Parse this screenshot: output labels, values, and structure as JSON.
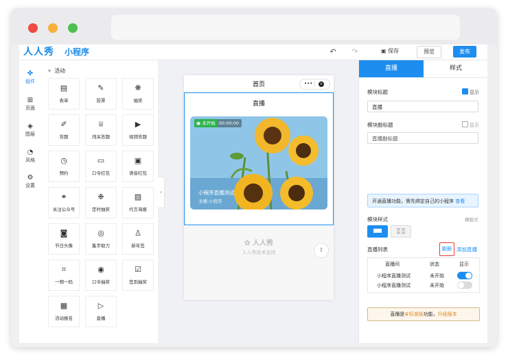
{
  "header": {
    "logo": "人人秀",
    "logo_sub": "小程序",
    "save_label": "保存",
    "preview_label": "预览",
    "publish_label": "发布",
    "colors": {
      "accent": "#1d8ef0",
      "brand": "#1a8ce8"
    }
  },
  "rail": [
    {
      "label": "组件",
      "icon": "puzzle-icon"
    },
    {
      "label": "页面",
      "icon": "plus-square-icon"
    },
    {
      "label": "图层",
      "icon": "layers-icon"
    },
    {
      "label": "风格",
      "icon": "palette-icon"
    },
    {
      "label": "设置",
      "icon": "settings-icon"
    }
  ],
  "components": {
    "section_title": "活动",
    "items": [
      {
        "label": "表单",
        "icon": "form-icon"
      },
      {
        "label": "投票",
        "icon": "vote-icon"
      },
      {
        "label": "抽奖",
        "icon": "lottery-icon"
      },
      {
        "label": "答题",
        "icon": "pen-icon"
      },
      {
        "label": "闯关答题",
        "icon": "trophy-icon"
      },
      {
        "label": "视频答题",
        "icon": "video-icon"
      },
      {
        "label": "预约",
        "icon": "clock-icon"
      },
      {
        "label": "口令红包",
        "icon": "envelope-icon"
      },
      {
        "label": "语音红包",
        "icon": "voice-envelope-icon"
      },
      {
        "label": "关注公众号",
        "icon": "follow-icon"
      },
      {
        "label": "定时抽奖",
        "icon": "timer-lottery-icon"
      },
      {
        "label": "代言海报",
        "icon": "poster-icon"
      },
      {
        "label": "节日头像",
        "icon": "avatar-frame-icon"
      },
      {
        "label": "集字助力",
        "icon": "char-collect-icon"
      },
      {
        "label": "新年签",
        "icon": "lot-icon"
      },
      {
        "label": "一物一码",
        "icon": "scan-code-icon"
      },
      {
        "label": "口令抽奖",
        "icon": "compass-icon"
      },
      {
        "label": "签到抽奖",
        "icon": "checkin-icon"
      },
      {
        "label": "活动报名",
        "icon": "signup-icon"
      },
      {
        "label": "直播",
        "icon": "live-icon"
      }
    ]
  },
  "canvas": {
    "page_title": "首页",
    "capsule_more": "•••",
    "module_title": "直播",
    "card": {
      "status": "未开始",
      "time": "00:00:00",
      "title": "小程序直播测试",
      "subtitle": "主播:小程序"
    },
    "watermark_brand": "人人秀",
    "watermark_tech": "人人秀技术支持"
  },
  "panel": {
    "tabs": [
      "直播",
      "样式"
    ],
    "module_title_label": "模块标题",
    "show_label": "显示",
    "module_title_value": "直播",
    "module_subtitle_label": "模块副标题",
    "module_subtitle_value": "直播副标题",
    "notice_text": "开通直播功能，需先绑定自己的小程序",
    "notice_link": "查看",
    "module_style_label": "模块样式",
    "horizontal_label": "横版式",
    "live_list_label": "直播列表",
    "refresh_label": "刷新",
    "add_live_label": "添加直播",
    "table_headers": [
      "直播间",
      "状态",
      "显示"
    ],
    "rows": [
      {
        "name": "小程序直播测试",
        "status": "未开始",
        "enabled": true
      },
      {
        "name": "小程序直播测试",
        "status": "未开始",
        "enabled": false
      }
    ],
    "upgrade_prefix": "直播是",
    "upgrade_badge": "标准版",
    "upgrade_middle": "功能，",
    "upgrade_link": "升级版本"
  }
}
